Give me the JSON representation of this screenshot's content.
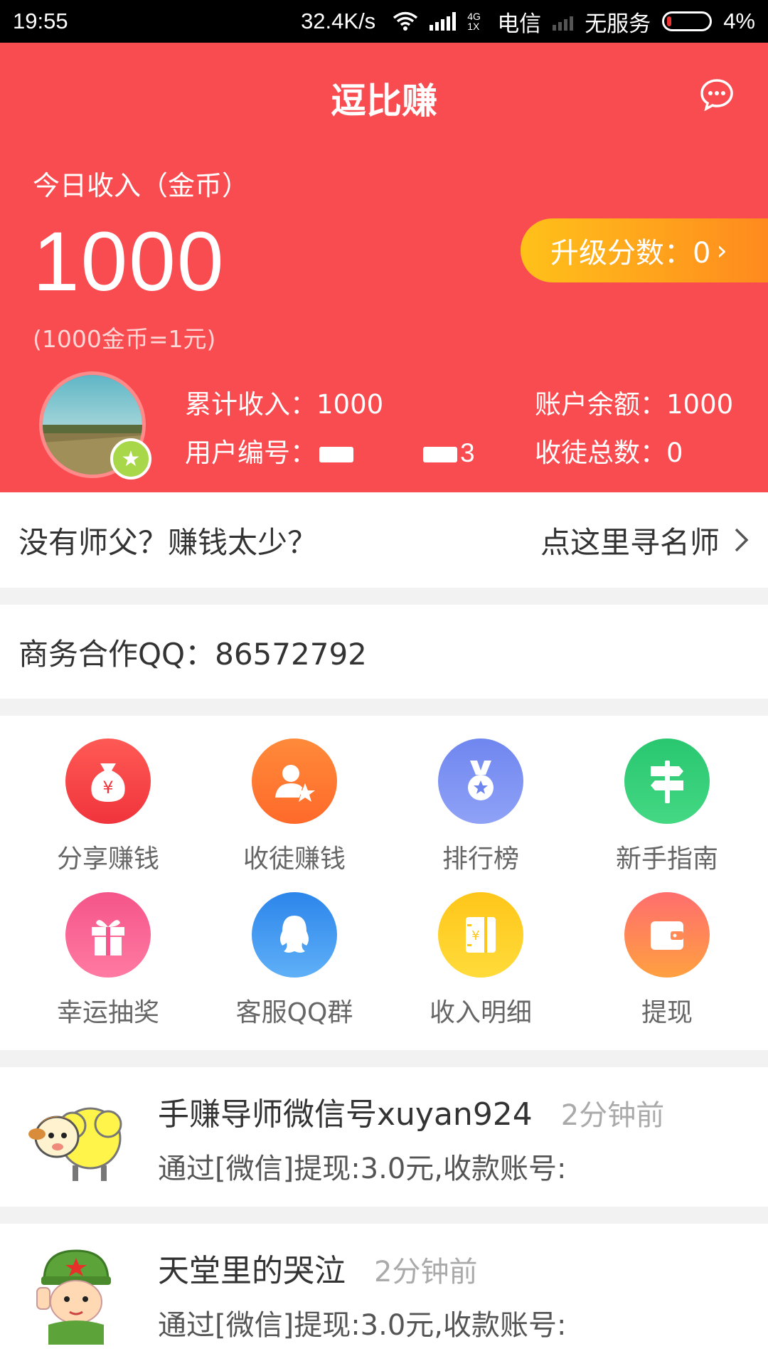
{
  "status_bar": {
    "time": "19:55",
    "speed": "32.4K/s",
    "network_type": "4G 1X",
    "carrier": "电信",
    "no_service": "无服务",
    "battery": "4%"
  },
  "header": {
    "title": "逗比赚",
    "income_label": "今日收入（金币）",
    "income_value": "1000",
    "rate_note": "(1000金币=1元)",
    "upgrade_label": "升级分数：0",
    "total_income": "累计收入：1000",
    "balance": "账户余额：1000",
    "user_id_label": "用户编号：",
    "user_id_tail": "3",
    "apprentice_total": "收徒总数：0",
    "colors": {
      "primary": "#f94c51",
      "upgrade_start": "#ffc11a",
      "upgrade_end": "#ff8a1e"
    }
  },
  "mentor_bar": {
    "left_text": "没有师父？赚钱太少？",
    "right_text": "点这里寻名师"
  },
  "business": {
    "qq_text": "商务合作QQ：86572792"
  },
  "grid": [
    {
      "label": "分享赚钱",
      "icon": "money-bag-icon",
      "color": "#f94c51"
    },
    {
      "label": "收徒赚钱",
      "icon": "user-star-icon",
      "color": "#ff7a2e"
    },
    {
      "label": "排行榜",
      "icon": "medal-icon",
      "color": "#6f86ef"
    },
    {
      "label": "新手指南",
      "icon": "signpost-icon",
      "color": "#2dcc70"
    },
    {
      "label": "幸运抽奖",
      "icon": "gift-icon",
      "color": "#f5558a"
    },
    {
      "label": "客服QQ群",
      "icon": "qq-icon",
      "color": "#3a93f0"
    },
    {
      "label": "收入明细",
      "icon": "ledger-icon",
      "color": "#ffc61a"
    },
    {
      "label": "提现",
      "icon": "wallet-icon",
      "color": "#ff7f4a"
    }
  ],
  "feed": [
    {
      "title": "手赚导师微信号xuyan924",
      "time": "2分钟前",
      "desc": "通过[微信]提现:3.0元,收款账号:",
      "avatar": "sheep-avatar-icon"
    },
    {
      "title": "天堂里的哭泣",
      "time": "2分钟前",
      "desc": "通过[微信]提现:3.0元,收款账号:",
      "avatar": "soldier-avatar-icon"
    }
  ]
}
